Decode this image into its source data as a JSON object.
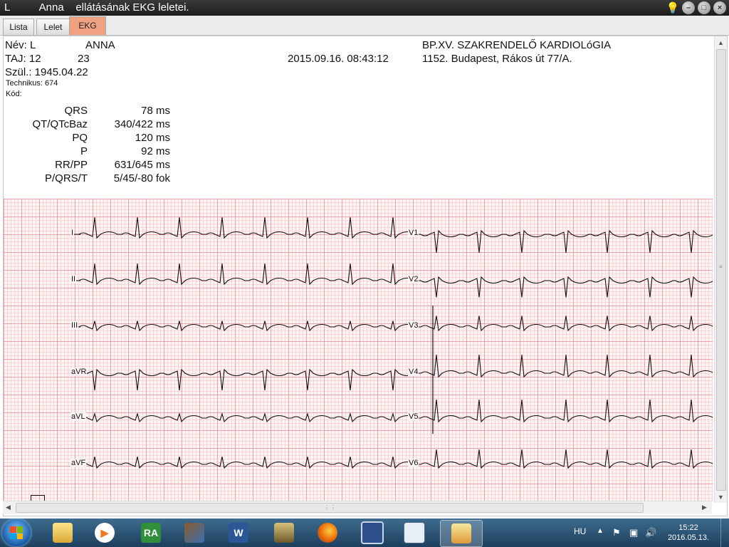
{
  "window": {
    "title": "L          Anna    ellátásának EKG leletei."
  },
  "tabs": [
    {
      "label": "Lista",
      "active": false
    },
    {
      "label": "Lelet",
      "active": false
    },
    {
      "label": "EKG",
      "active": true
    }
  ],
  "patient": {
    "name_label": "Név: L",
    "name_value": "ANNA",
    "taj_label": "TAJ: 12",
    "taj_value": "23",
    "birth": "Szül.: 1945.04.22",
    "technician": "Technikus: 674",
    "code": "Kód:"
  },
  "record_datetime": "2015.09.16. 08:43:12",
  "institution": {
    "name": "BP.XV. SZAKRENDELŐ KARDIOLóGIA",
    "address": "1152. Budapest, Rákos út 77/A."
  },
  "measurements": [
    {
      "label": "QRS",
      "value": "78 ms"
    },
    {
      "label": "QT/QTcBaz",
      "value": "340/422 ms"
    },
    {
      "label": "PQ",
      "value": "120 ms"
    },
    {
      "label": "P",
      "value": "92 ms"
    },
    {
      "label": "RR/PP",
      "value": "631/645 ms"
    },
    {
      "label": "P/QRS/T",
      "value": "5/45/-80 fok"
    }
  ],
  "ecg": {
    "grid_color": "#e67882",
    "trace_color": "#111111",
    "left_leads": [
      "I",
      "II",
      "III",
      "aVR",
      "aVL",
      "aVF"
    ],
    "right_leads": [
      "V1",
      "V2",
      "V3",
      "V4",
      "V5",
      "V6"
    ]
  },
  "taskbar": {
    "apps": [
      {
        "icon": "explorer-folder-icon"
      },
      {
        "icon": "media-player-icon"
      },
      {
        "icon": "ra-app-icon",
        "text": "RA"
      },
      {
        "icon": "archive-app-icon"
      },
      {
        "icon": "word-icon",
        "text": "W"
      },
      {
        "icon": "game-app-icon"
      },
      {
        "icon": "firefox-icon"
      },
      {
        "icon": "save-disk-icon"
      },
      {
        "icon": "calculator-window-icon"
      },
      {
        "icon": "ekg-app-icon",
        "active": true
      }
    ],
    "language": "HU",
    "time": "15:22",
    "date": "2016.05.13."
  }
}
